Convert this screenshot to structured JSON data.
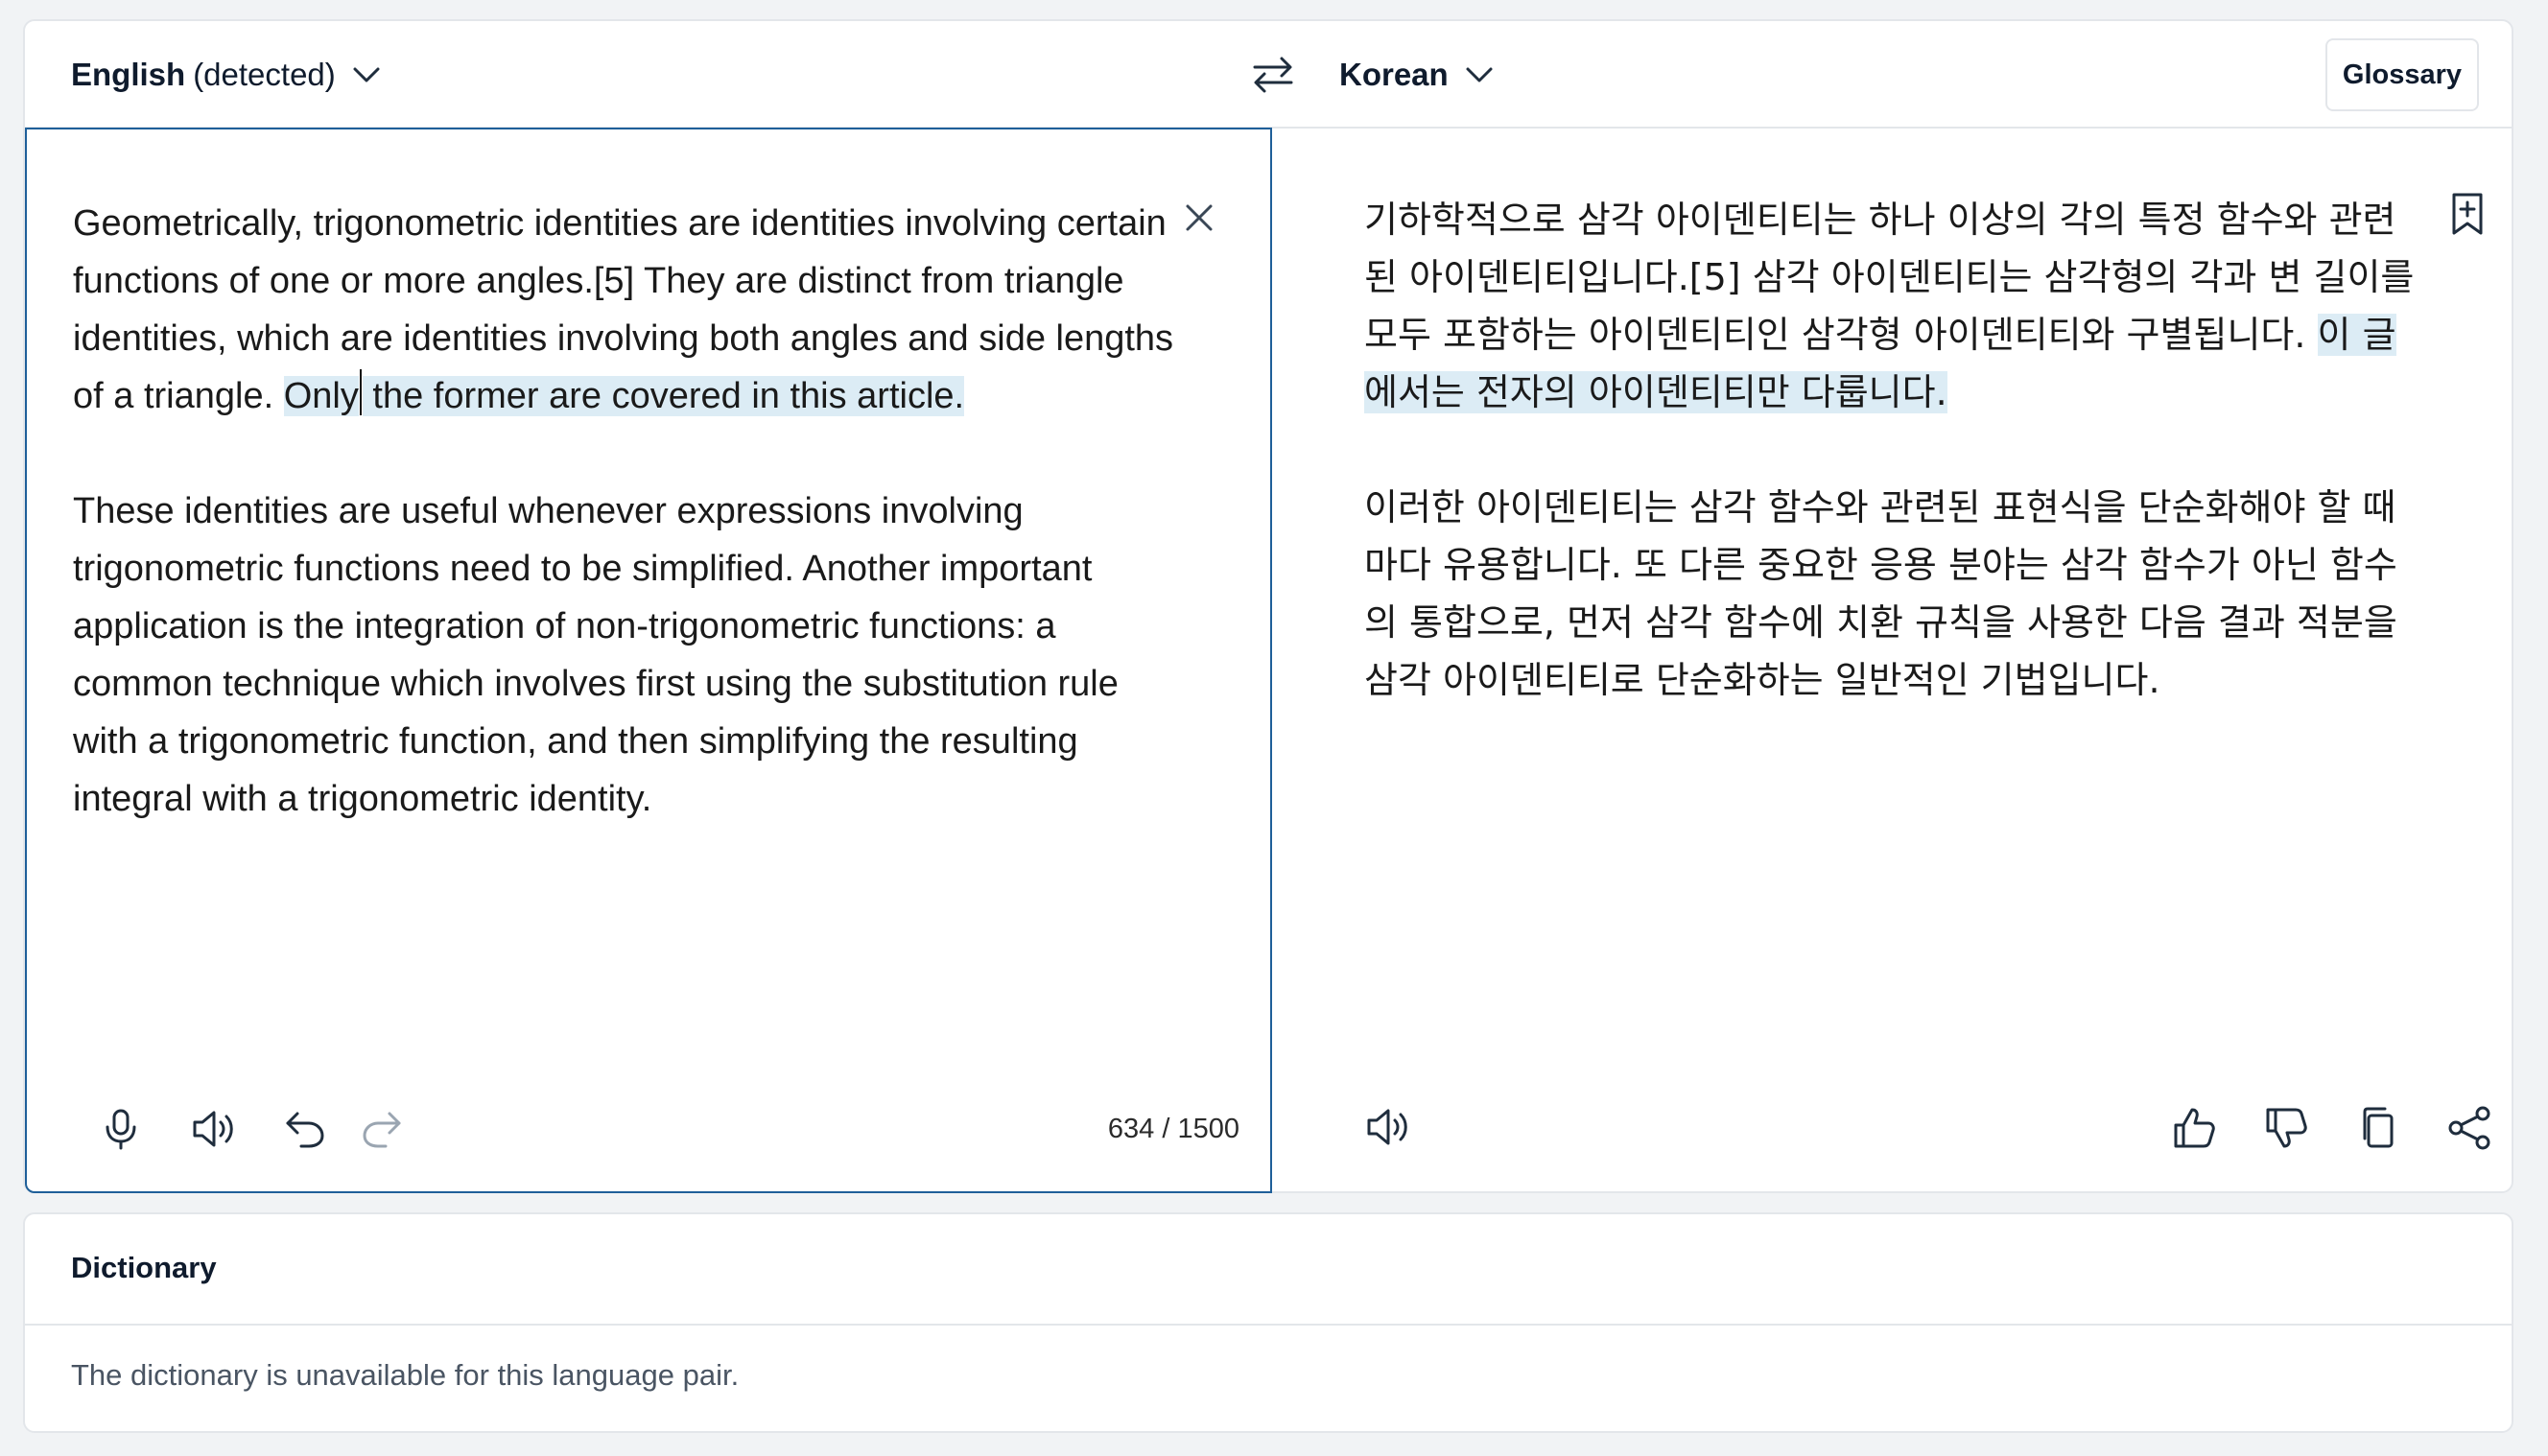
{
  "source_language": {
    "name": "English",
    "detected_label": "(detected)"
  },
  "target_language": {
    "name": "Korean"
  },
  "header": {
    "glossary_label": "Glossary"
  },
  "source": {
    "paragraph1_before": "Geometrically, trigonometric identities are identities involving certain functions of one or more angles.[5] They are distinct from triangle identities, which are identities involving both angles and side lengths of a triangle. ",
    "paragraph1_highlight_a": "Only",
    "paragraph1_highlight_b": " the former are covered in this article.",
    "paragraph2": "These identities are useful whenever expressions involving trigonometric functions need to be simplified. Another important application is the integration of non-trigonometric functions: a common technique which involves first using the substitution rule with a trigonometric function, and then simplifying the resulting integral with a trigonometric identity.",
    "char_count": "634 / 1500"
  },
  "target": {
    "paragraph1_before": "기하학적으로 삼각 아이덴티티는 하나 이상의 각의 특정 함수와 관련된 아이덴티티입니다.[5] 삼각 아이덴티티는 삼각형의 각과 변 길이를 모두 포함하는 아이덴티티인 삼각형 아이덴티티와 구별됩니다. ",
    "paragraph1_highlight": "이 글에서는 전자의 아이덴티티만 다룹니다.",
    "paragraph2": "이러한 아이덴티티는 삼각 함수와 관련된 표현식을 단순화해야 할 때마다 유용합니다. 또 다른 중요한 응용 분야는 삼각 함수가 아닌 함수의 통합으로, 먼저 삼각 함수에 치환 규칙을 사용한 다음 결과 적분을 삼각 아이덴티티로 단순화하는 일반적인 기법입니다."
  },
  "dictionary": {
    "title": "Dictionary",
    "message": "The dictionary is unavailable for this language pair."
  },
  "colors": {
    "accent_border": "#1f5f99",
    "highlight": "#dcecf5",
    "icon": "#1f2d3d"
  },
  "icons": {
    "source_toolbar": [
      "microphone-icon",
      "speaker-icon",
      "undo-icon",
      "redo-icon"
    ],
    "target_toolbar": [
      "speaker-icon",
      "thumbs-up-icon",
      "thumbs-down-icon",
      "copy-icon",
      "share-icon"
    ]
  }
}
